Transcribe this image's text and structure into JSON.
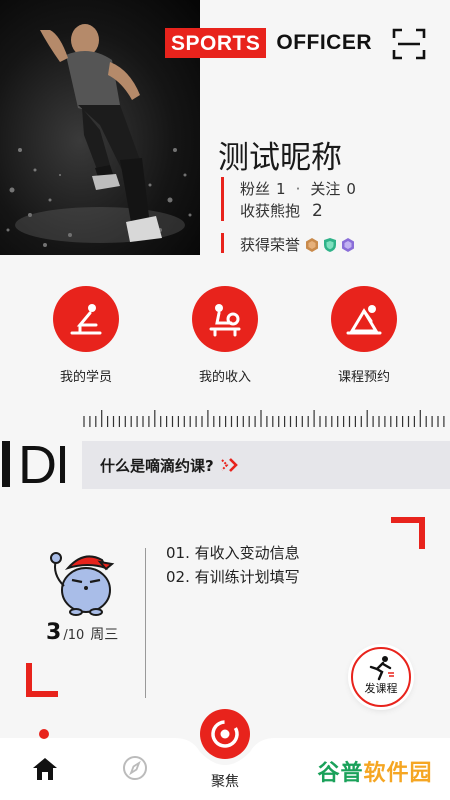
{
  "brand": {
    "part1": "SPORTS",
    "part2": "OFFICER"
  },
  "profile": {
    "nickname": "测试昵称",
    "fans_label": "粉丝",
    "fans_count": "1",
    "separator": "·",
    "follow_label": "关注",
    "follow_count": "0",
    "hugs_label": "收获熊抱",
    "hugs_count": "2",
    "honors_label": "获得荣誉",
    "honor_badges": [
      "bronze-badge-icon",
      "green-badge-icon",
      "purple-badge-icon"
    ]
  },
  "actions": [
    {
      "label": "我的学员",
      "icon": "student-icon"
    },
    {
      "label": "我的收入",
      "icon": "income-icon"
    },
    {
      "label": "课程预约",
      "icon": "booking-icon"
    }
  ],
  "promo": {
    "logo_text": "DI",
    "text": "什么是嘀滴约课?"
  },
  "schedule": {
    "day": "3",
    "month_suffix": "/10",
    "weekday": "周三",
    "tasks": [
      "01.  有收入变动信息",
      "02.  有训练计划填写"
    ]
  },
  "fab": {
    "label": "发课程"
  },
  "nav": {
    "items": [
      {
        "icon": "home-icon"
      },
      {
        "icon": "compass-icon"
      },
      {
        "icon": "focus-icon",
        "label": "聚焦"
      }
    ]
  },
  "watermark": {
    "text_a": "谷普",
    "text_b": "软件园"
  },
  "colors": {
    "accent": "#e8231c",
    "text": "#1a1a1a",
    "background": "#f6f6f6"
  }
}
